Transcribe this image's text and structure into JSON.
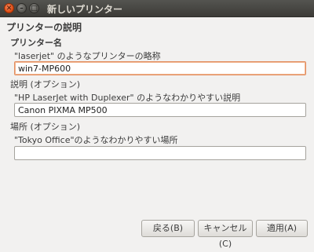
{
  "window": {
    "title": "新しいプリンター",
    "close_glyph": "✕",
    "minimize_glyph": "–",
    "maximize_glyph": "□"
  },
  "section_title": "プリンターの説明",
  "printer_name": {
    "label": "プリンター名",
    "hint": "\"laserjet\" のようなプリンターの略称",
    "value": "win7-MP600"
  },
  "description": {
    "label": "説明 (オプション)",
    "hint": "\"HP LaserJet with Duplexer\" のようなわかりやすい説明",
    "value": "Canon PIXMA MP500"
  },
  "location": {
    "label": "場所 (オプション)",
    "hint": "\"Tokyo Office\"のようなわかりやすい場所",
    "value": ""
  },
  "buttons": {
    "back": "戻る(B)",
    "cancel": "キャンセル(C)",
    "apply": "適用(A)"
  }
}
